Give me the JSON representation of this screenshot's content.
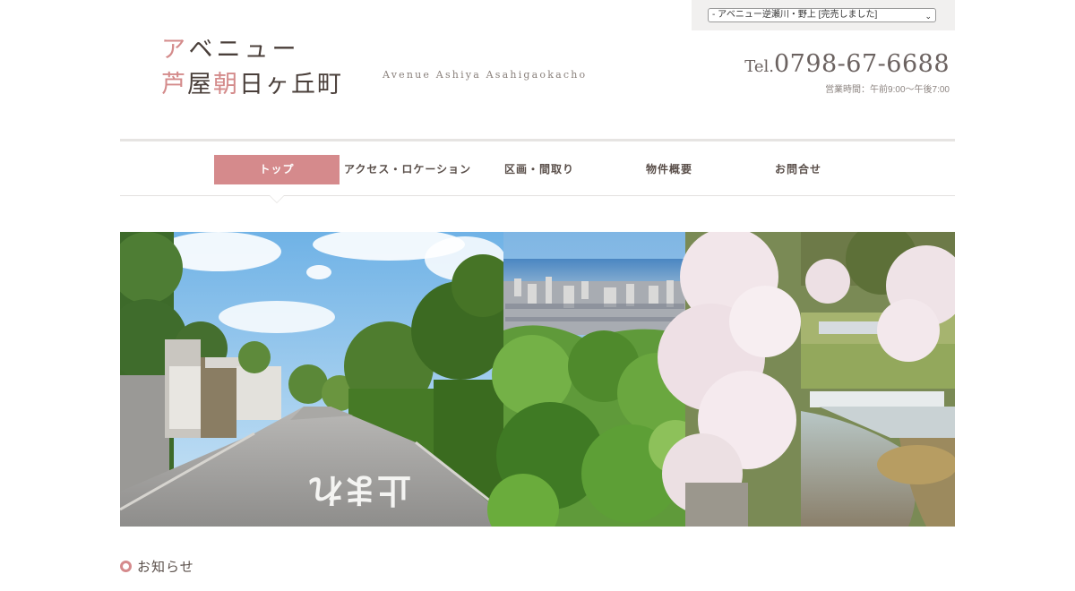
{
  "header": {
    "project_select": {
      "selected": "- アベニュー逆瀬川・野上 [完売しました]"
    },
    "logo": {
      "line1": "アベニュー",
      "line2_a": "芦屋",
      "line2_b": "朝",
      "line2_c": "日ヶ丘町",
      "english": "Avenue Ashiya Asahigaokacho"
    },
    "contact": {
      "tel_prefix": "Tel.",
      "tel_number": "0798-67-6688",
      "hours": "営業時間：午前9:00～午後7:00"
    }
  },
  "nav": {
    "items": [
      {
        "label": "トップ",
        "active": true
      },
      {
        "label": "アクセス・ロケーション"
      },
      {
        "label": "区画・間取り"
      },
      {
        "label": "物件概要"
      },
      {
        "label": "お問合せ"
      }
    ]
  },
  "hero": {
    "road_marking": "止まれ"
  },
  "news": {
    "title": "お知らせ"
  },
  "colors": {
    "accent": "#d58a8c",
    "text": "#5a4f4a",
    "topbar_bg": "#f1f0ef"
  }
}
